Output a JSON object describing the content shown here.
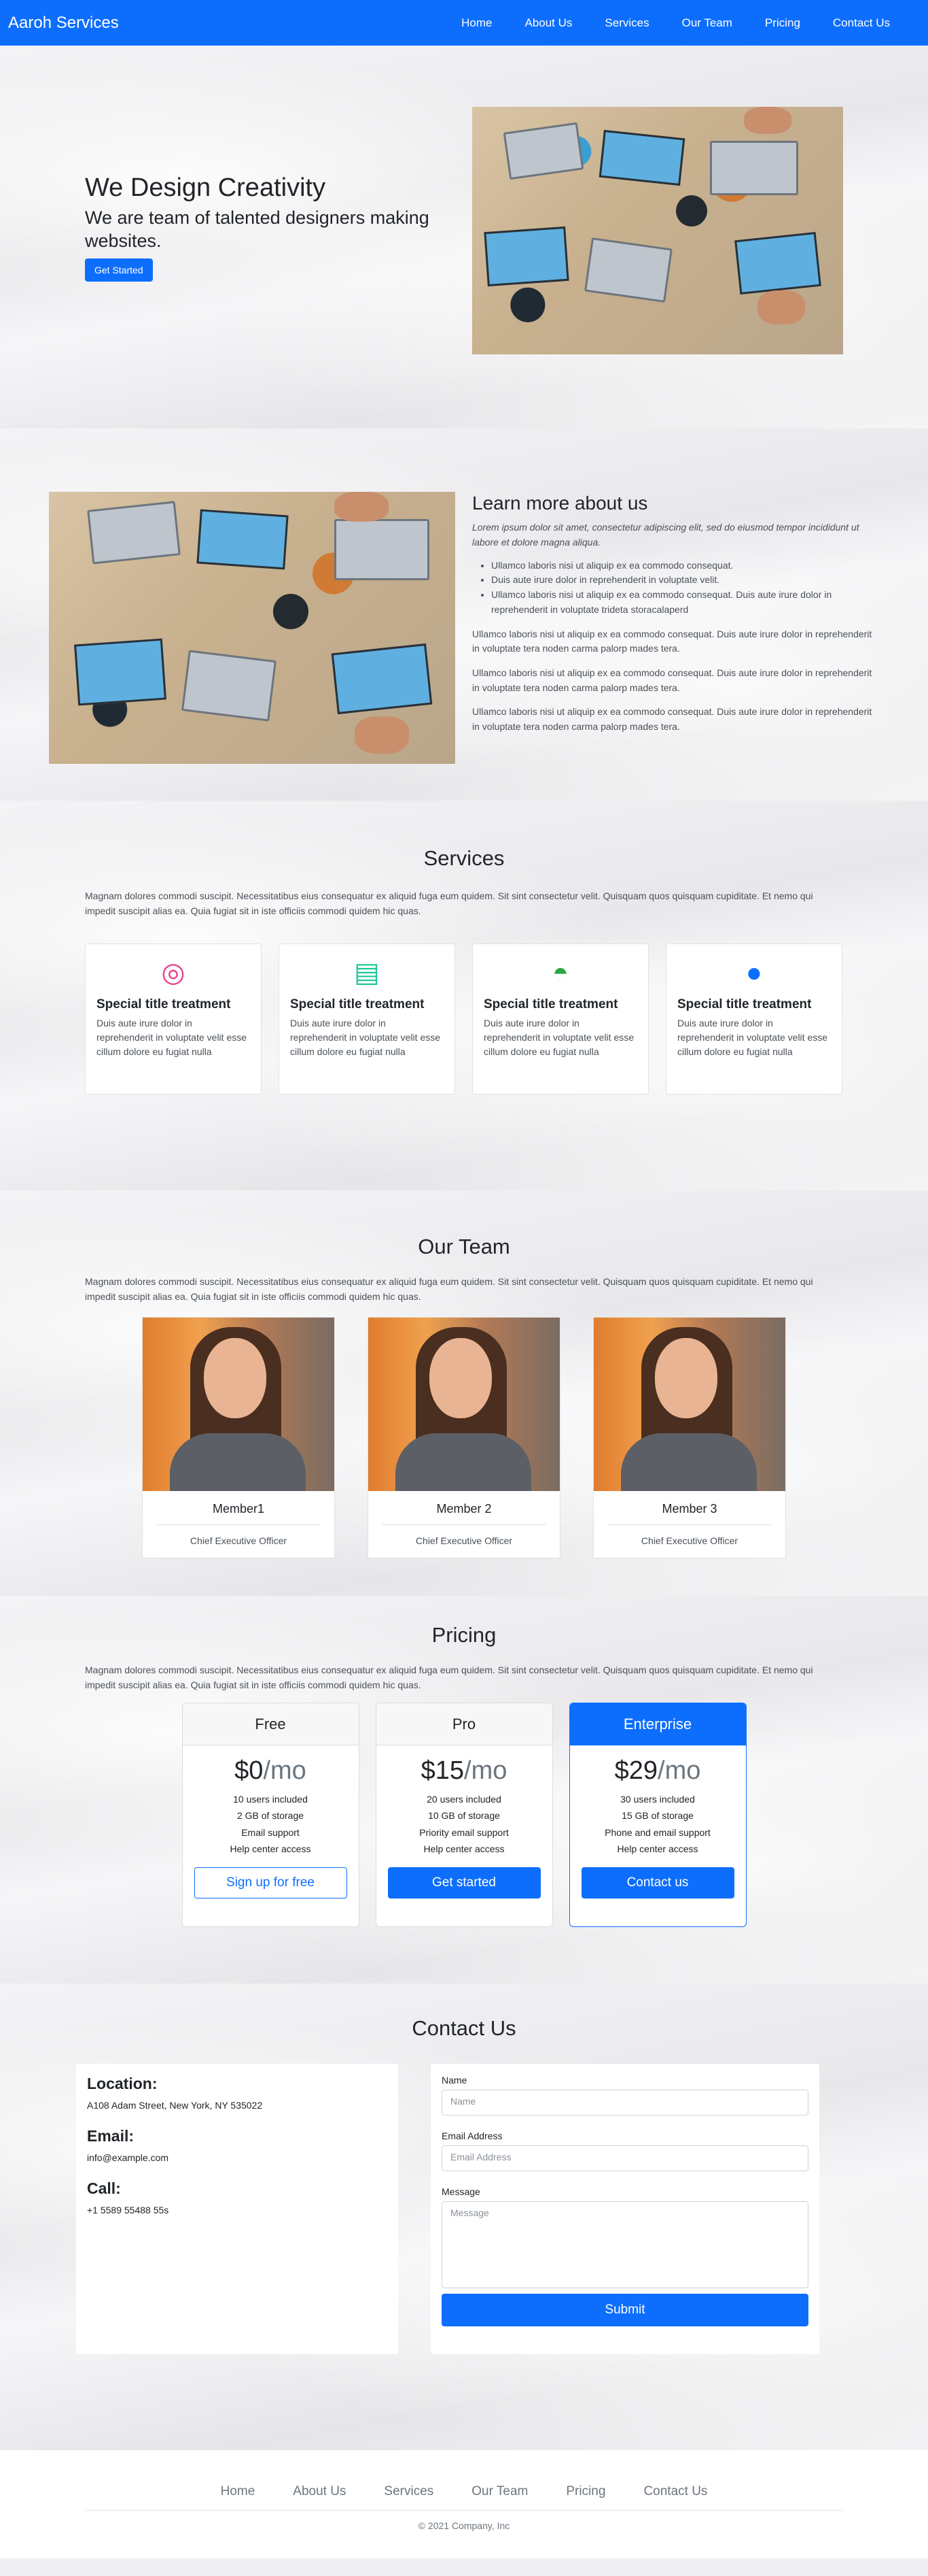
{
  "nav": {
    "brand": "Aaroh Services",
    "links": [
      "Home",
      "About Us",
      "Services",
      "Our Team",
      "Pricing",
      "Contact Us"
    ]
  },
  "hero": {
    "title": "We Design Creativity",
    "subtitle": "We are team of talented designers making websites.",
    "cta": "Get Started"
  },
  "about": {
    "title": "Learn more about us",
    "lead": "Lorem ipsum dolor sit amet, consectetur adipiscing elit, sed do eiusmod tempor incididunt ut labore et dolore magna aliqua.",
    "bullets": [
      "Ullamco laboris nisi ut aliquip ex ea commodo consequat.",
      "Duis aute irure dolor in reprehenderit in voluptate velit.",
      "Ullamco laboris nisi ut aliquip ex ea commodo consequat. Duis aute irure dolor in reprehenderit in voluptate trideta storacalaperd"
    ],
    "paragraphs": [
      "Ullamco laboris nisi ut aliquip ex ea commodo consequat. Duis aute irure dolor in reprehenderit in voluptate tera noden carma palorp mades tera.",
      "Ullamco laboris nisi ut aliquip ex ea commodo consequat. Duis aute irure dolor in reprehenderit in voluptate tera noden carma palorp mades tera.",
      "Ullamco laboris nisi ut aliquip ex ea commodo consequat. Duis aute irure dolor in reprehenderit in voluptate tera noden carma palorp mades tera."
    ]
  },
  "section_desc": "Magnam dolores commodi suscipit. Necessitatibus eius consequatur ex aliquid fuga eum quidem. Sit sint consectetur velit. Quisquam quos quisquam cupiditate. Et nemo qui impedit suscipit alias ea. Quia fugiat sit in iste officiis commodi quidem hic quas.",
  "services": {
    "title": "Services",
    "cards": [
      {
        "icon": "dribbble-icon",
        "glyph": "◎",
        "color": "#e83e8c",
        "title": "Special title treatment",
        "text": "Duis aute irure dolor in reprehenderit in voluptate velit esse cillum dolore eu fugiat nulla"
      },
      {
        "icon": "document-icon",
        "glyph": "▤",
        "color": "#20c997",
        "title": "Special title treatment",
        "text": "Duis aute irure dolor in reprehenderit in voluptate velit esse cillum dolore eu fugiat nulla"
      },
      {
        "icon": "speedometer-icon",
        "glyph": "◓",
        "color": "#28a745",
        "title": "Special title treatment",
        "text": "Duis aute irure dolor in reprehenderit in voluptate velit esse cillum dolore eu fugiat nulla"
      },
      {
        "icon": "globe-icon",
        "glyph": "●",
        "color": "#0d6efd",
        "title": "Special title treatment",
        "text": "Duis aute irure dolor in reprehenderit in voluptate velit esse cillum dolore eu fugiat nulla"
      }
    ]
  },
  "team": {
    "title": "Our Team",
    "members": [
      {
        "name": "Member1",
        "role": "Chief Executive Officer"
      },
      {
        "name": "Member 2",
        "role": "Chief Executive Officer"
      },
      {
        "name": "Member 3",
        "role": "Chief Executive Officer"
      }
    ]
  },
  "pricing": {
    "title": "Pricing",
    "plans": [
      {
        "name": "Free",
        "price": "$0",
        "unit": "/mo",
        "features": [
          "10 users included",
          "2 GB of storage",
          "Email support",
          "Help center access"
        ],
        "button": "Sign up for free"
      },
      {
        "name": "Pro",
        "price": "$15",
        "unit": "/mo",
        "features": [
          "20 users included",
          "10 GB of storage",
          "Priority email support",
          "Help center access"
        ],
        "button": "Get started"
      },
      {
        "name": "Enterprise",
        "price": "$29",
        "unit": "/mo",
        "features": [
          "30 users included",
          "15 GB of storage",
          "Phone and email support",
          "Help center access"
        ],
        "button": "Contact us"
      }
    ]
  },
  "contact": {
    "title": "Contact Us",
    "location_label": "Location:",
    "location": "A108 Adam Street, New York, NY 535022",
    "email_label": "Email:",
    "email": "info@example.com",
    "call_label": "Call:",
    "phone": "+1 5589 55488 55s",
    "form": {
      "name_label": "Name",
      "name_placeholder": "Name",
      "email_label": "Email Address",
      "email_placeholder": "Email Address",
      "message_label": "Message",
      "message_placeholder": "Message",
      "submit": "Submit"
    }
  },
  "footer": {
    "links": [
      "Home",
      "About Us",
      "Services",
      "Our Team",
      "Pricing",
      "Contact Us"
    ],
    "copyright": "© 2021 Company, Inc"
  },
  "colors": {
    "primary": "#0d6efd"
  }
}
